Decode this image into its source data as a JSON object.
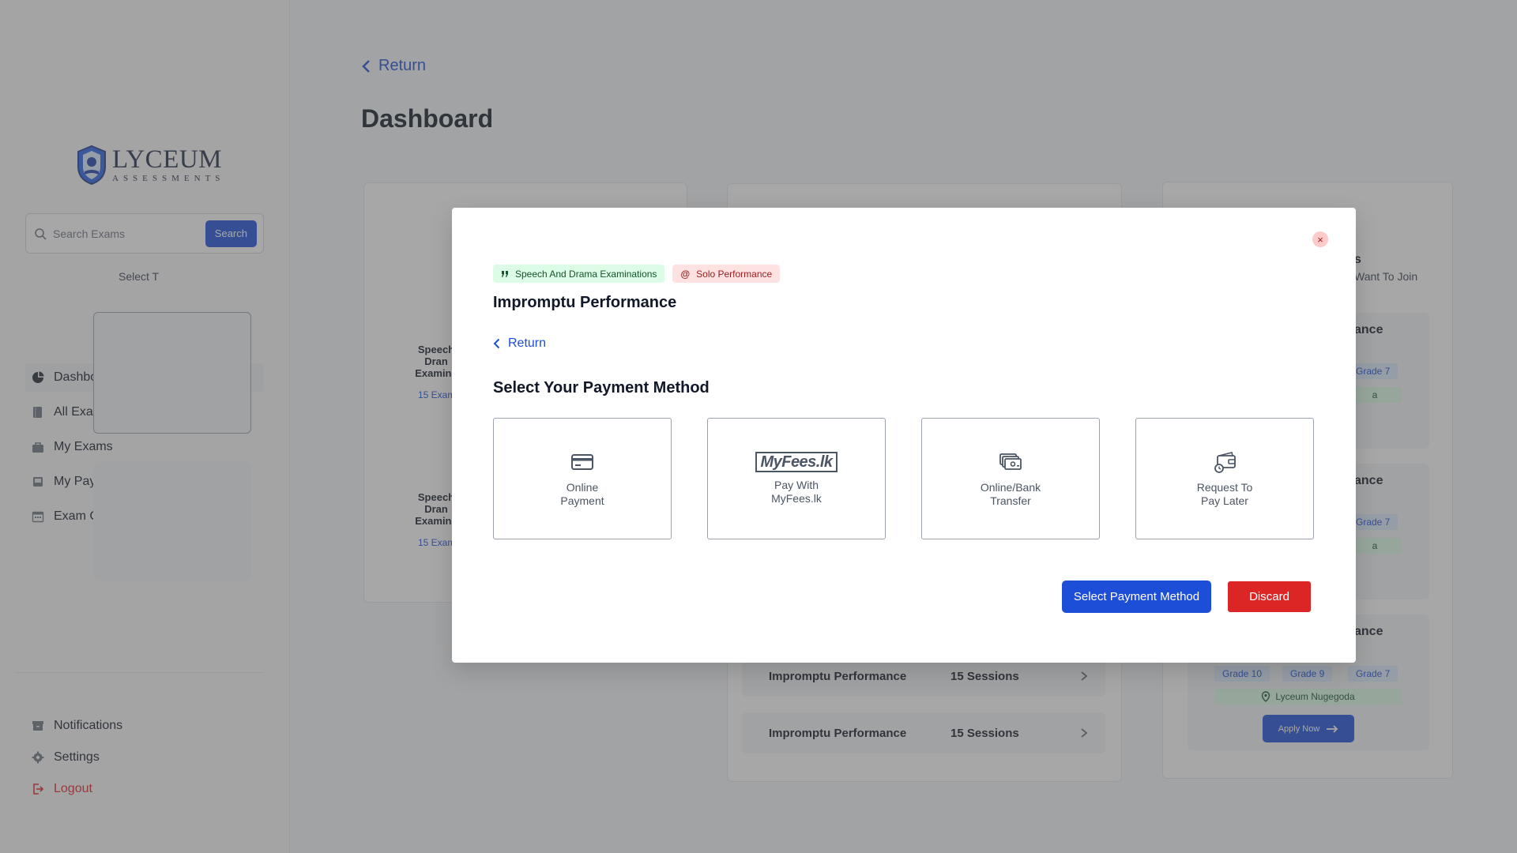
{
  "sidebar": {
    "logo": {
      "name": "LYCEUM",
      "tagline": "ASSESSMENTS"
    },
    "search": {
      "placeholder": "Search Exams",
      "button_label": "Search"
    },
    "nav_items": [
      {
        "label": "Dashboard",
        "icon": "pie-chart-icon",
        "active": true
      },
      {
        "label": "All Exams",
        "icon": "book-icon"
      },
      {
        "label": "My Exams",
        "icon": "briefcase-icon"
      },
      {
        "label": "My Payments",
        "icon": "inbox-icon"
      },
      {
        "label": "Exam Calendar",
        "icon": "calendar-icon"
      }
    ],
    "bottom_items": [
      {
        "label": "Notifications",
        "icon": "archive-icon"
      },
      {
        "label": "Settings",
        "icon": "gear-icon"
      },
      {
        "label": "Logout",
        "icon": "logout-icon",
        "color": "#dc2626"
      }
    ]
  },
  "main": {
    "back_label": "Return",
    "page_title": "Dashboard",
    "card1": {
      "subtitle_fragment": "Select T",
      "items": [
        {
          "title_lines": [
            "Speech",
            "Dran",
            "Examina"
          ],
          "meta": "15 Exam"
        },
        {
          "title_lines": [
            "Speech",
            "Dran",
            "Examina"
          ],
          "meta": "15 Exam"
        }
      ]
    },
    "card2": {
      "rows": [
        {
          "name": "Impromptu Performance",
          "sessions": "15 Sessions"
        },
        {
          "name": "Impromptu Performance",
          "sessions": "15 Sessions"
        }
      ]
    },
    "card3": {
      "heading_fragment": "s",
      "subtitle_fragment": "Want To Join",
      "panels": [
        {
          "title_fragment": "ance",
          "grade_chip": "Grade 7",
          "location_fragment": "a"
        },
        {
          "title_fragment": "ance",
          "grade_chip": "Grade 7",
          "location_fragment": "a"
        },
        {
          "title_fragment": "ance",
          "grade_chips": [
            "Grade 10",
            "Grade 9",
            "Grade 7"
          ],
          "location": "Lyceum Nugegoda",
          "apply_label": "Apply Now"
        }
      ]
    }
  },
  "modal": {
    "close_label": "×",
    "tags": [
      {
        "label": "Speech And Drama Examinations",
        "icon": "quote-icon",
        "color": "#dcfce7"
      },
      {
        "label": "Solo Performance",
        "icon": "at-icon",
        "color": "#fee2e2"
      }
    ],
    "title": "Impromptu Performance",
    "back_label": "Return",
    "section_title": "Select Your Payment Method",
    "methods": [
      {
        "line1": "Online",
        "line2": "Payment",
        "icon": "credit-card-icon"
      },
      {
        "line1": "Pay With",
        "line2": "MyFees.lk",
        "icon": "myfees-logo-icon",
        "logo_text": "MyFees.lk"
      },
      {
        "line1": "Online/Bank",
        "line2": "Transfer",
        "icon": "cash-icon"
      },
      {
        "line1": "Request To",
        "line2": "Pay Later",
        "icon": "wallet-clock-icon"
      }
    ],
    "primary_button": "Select Payment Method",
    "discard_button": "Discard"
  },
  "colors": {
    "accent": "#1d4ed8",
    "danger": "#dc2626",
    "overlay": "rgba(80,80,80,0.5)"
  }
}
